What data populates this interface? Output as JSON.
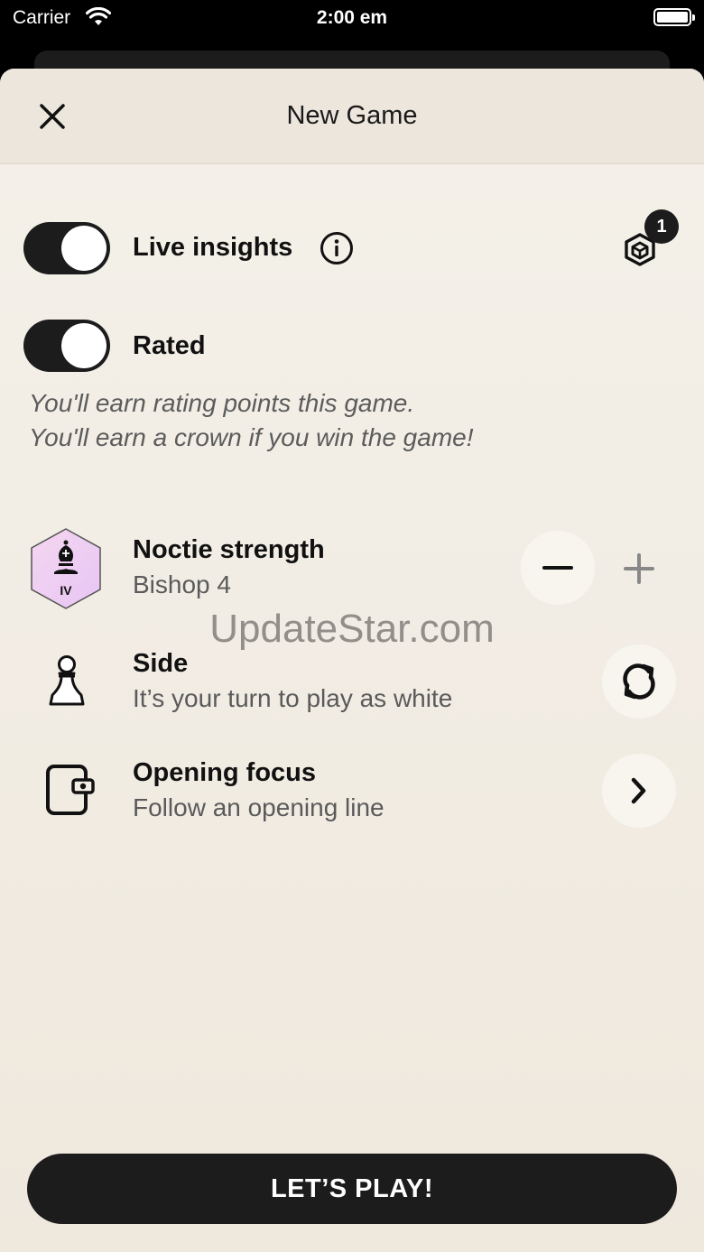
{
  "status_bar": {
    "carrier": "Carrier",
    "time": "2:00 em"
  },
  "header": {
    "title": "New Game"
  },
  "live_insights": {
    "label": "Live insights",
    "enabled": true
  },
  "badge": {
    "count": "1"
  },
  "rated": {
    "label": "Rated",
    "enabled": true,
    "description_line1": "You'll earn rating points this game.",
    "description_line2": "You'll earn a crown if you win the game!"
  },
  "strength": {
    "title": "Noctie strength",
    "value": "Bishop 4",
    "level_numeral": "IV"
  },
  "side": {
    "title": "Side",
    "description": "It’s your turn to play as white"
  },
  "opening": {
    "title": "Opening focus",
    "description": "Follow an opening line"
  },
  "watermark": "UpdateStar.com",
  "play_button": "LET’S PLAY!"
}
